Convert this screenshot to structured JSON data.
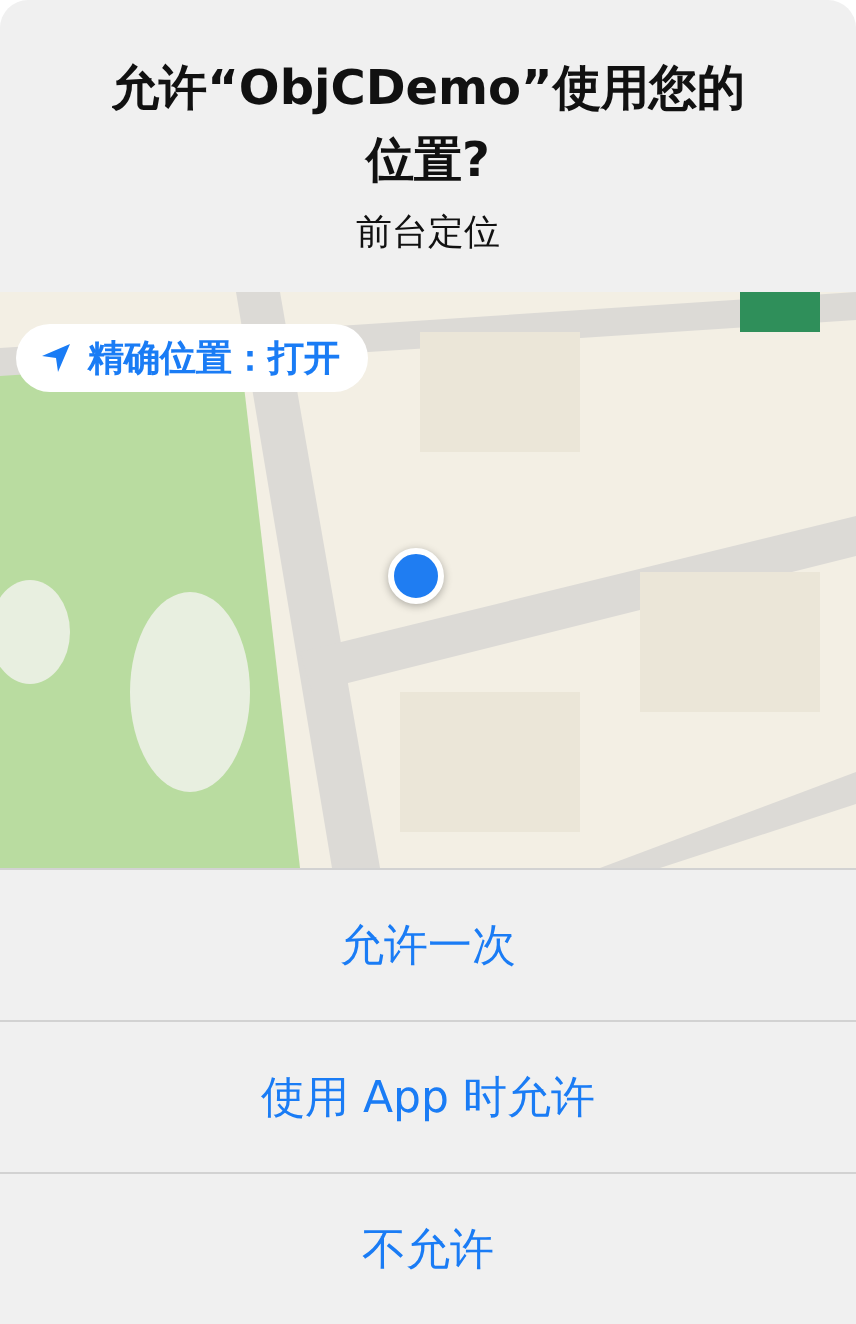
{
  "alert": {
    "title": "允许“ObjCDemo”使用您的位置?",
    "subtitle": "前台定位"
  },
  "map": {
    "kind": "picture",
    "precise_location": {
      "label": "精确位置：打开"
    }
  },
  "buttons": [
    "允许一次",
    "使用 App 时允许",
    "不允许"
  ]
}
